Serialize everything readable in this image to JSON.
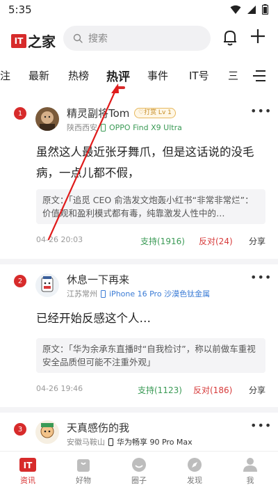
{
  "status_bar": {
    "time": "5:35"
  },
  "header": {
    "logo_box": "IT",
    "logo_text": "之家",
    "search_placeholder": "搜索"
  },
  "tabs": {
    "items": [
      "注",
      "最新",
      "热榜",
      "热评",
      "事件",
      "IT号",
      "三"
    ],
    "active": "热评"
  },
  "feed": [
    {
      "rank": "1",
      "username": "精灵副将Tom",
      "badge": "♡打赏 Lv 1",
      "location": "陕西西安",
      "device": "OPPO Find X9 Ultra",
      "comment": "虽然这人最近张牙舞爪，但是这话说的没毛病，一点儿都不假，",
      "quote": "原文：「追觅 CEO 俞浩发文炮轰小红书“非常非常烂”：价值观和盈利模式都有毒，纯靠激发人性中的…",
      "date": "04-26 20:03",
      "support": "支持(1916)",
      "oppose": "反对(24)",
      "share": "分享"
    },
    {
      "rank": "2",
      "username": "休息一下再来",
      "location": "江苏常州",
      "device": "iPhone 16 Pro 沙漠色钛金属",
      "comment": "已经开始反感这个人…",
      "quote": "原文：「华为余承东直播时“自我检讨”，称以前做车重视安全品质但可能不注重外观」",
      "date": "04-26 19:46",
      "support": "支持(1123)",
      "oppose": "反对(186)",
      "share": "分享"
    },
    {
      "rank": "3",
      "username": "天真感伤的我",
      "location": "安徽马鞍山",
      "device": "华为畅享 90 Pro Max"
    }
  ],
  "bottom_nav": [
    {
      "label": "资讯",
      "icon": "it-home-icon",
      "active": true
    },
    {
      "label": "好物",
      "icon": "shopping-bag-icon",
      "active": false
    },
    {
      "label": "圈子",
      "icon": "circle-smile-icon",
      "active": false
    },
    {
      "label": "发现",
      "icon": "compass-icon",
      "active": false
    },
    {
      "label": "我",
      "icon": "person-icon",
      "active": false
    }
  ],
  "colors": {
    "accent": "#d72b2b",
    "support": "#3a9a55",
    "oppose": "#d73a3a",
    "device_link": "#3a7bd5"
  }
}
